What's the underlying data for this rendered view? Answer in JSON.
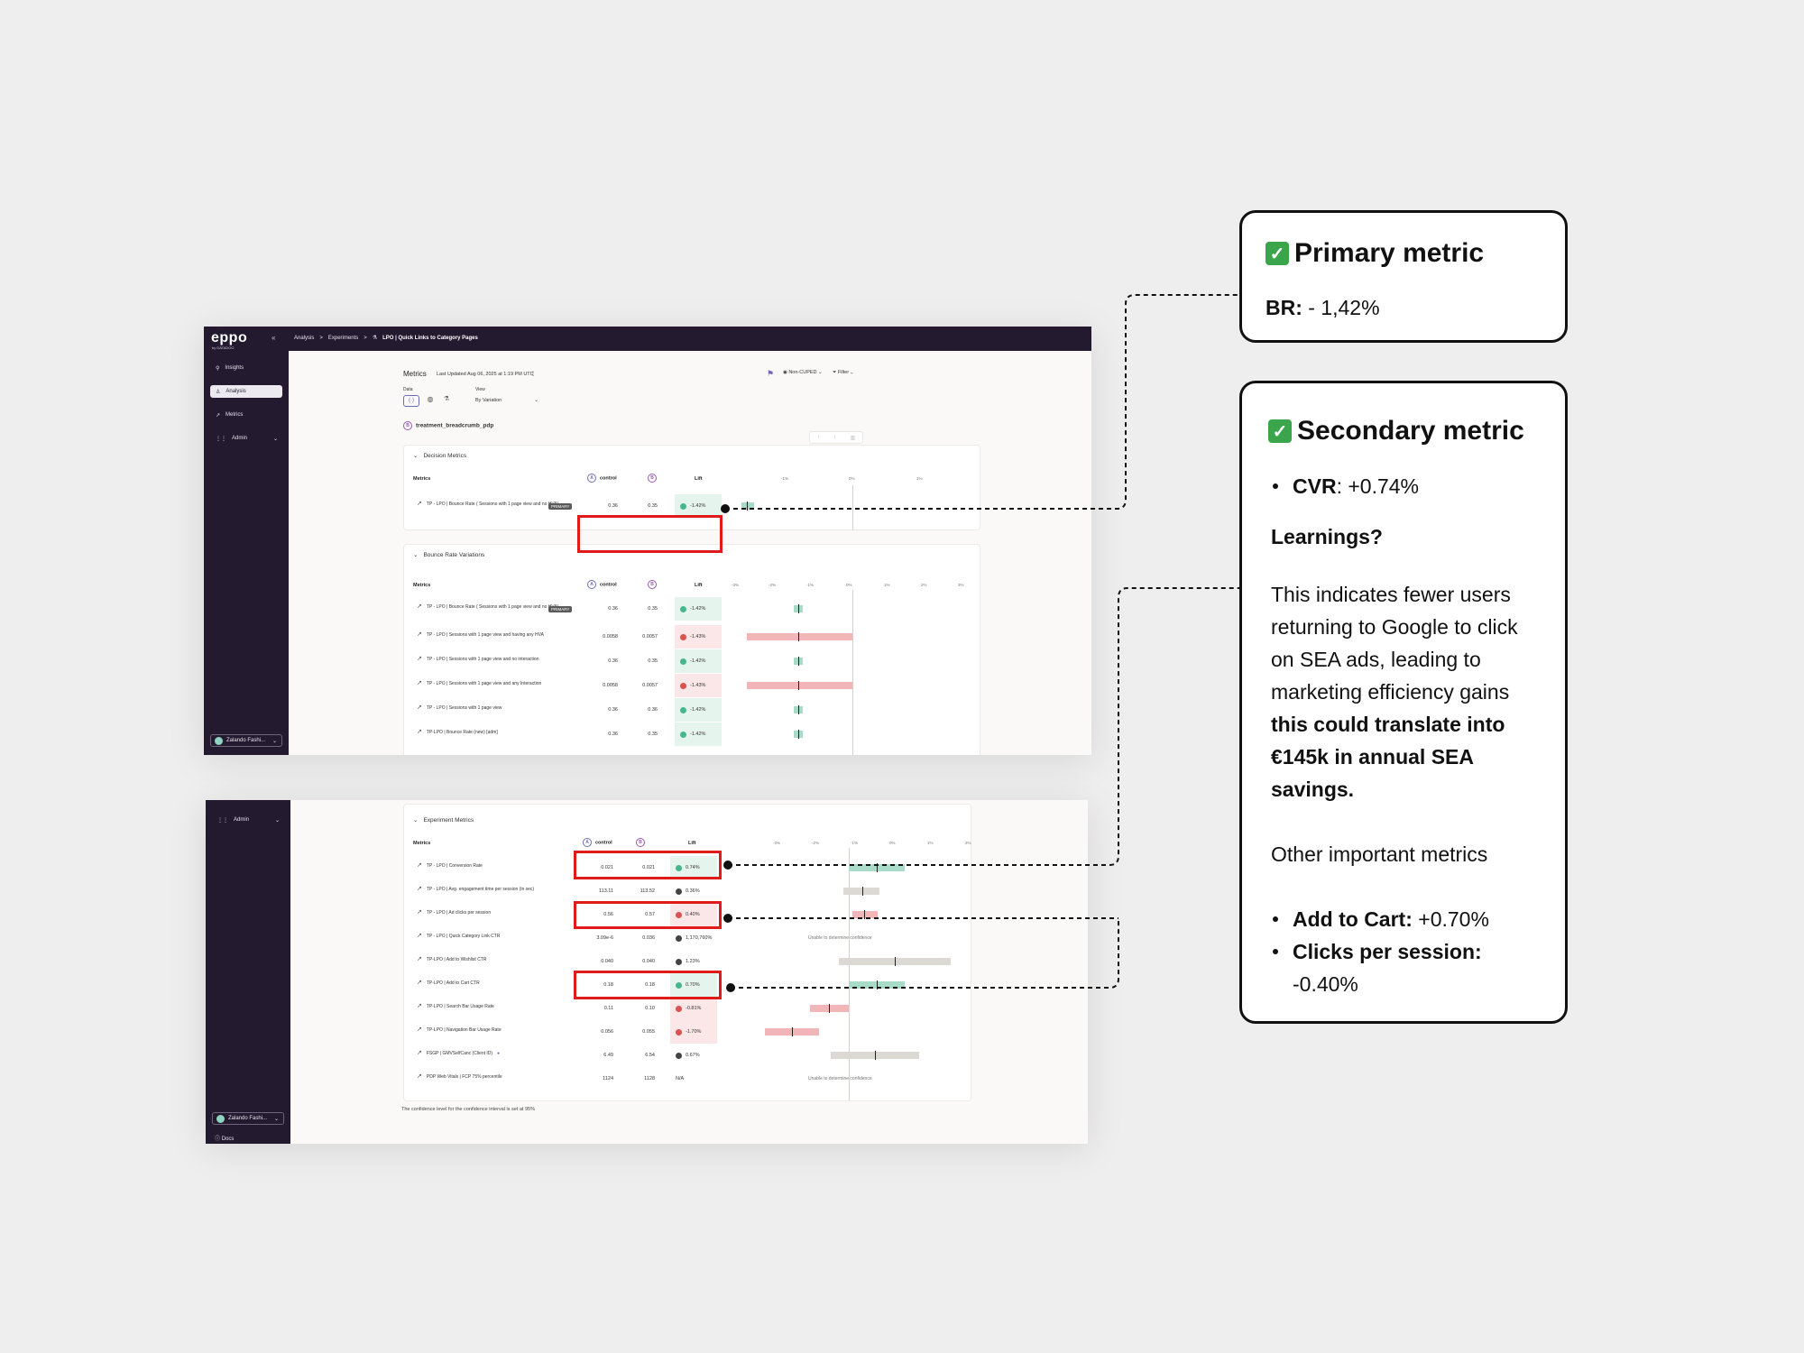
{
  "app": {
    "logo": "eppo",
    "logo_sub": "by DATADOG",
    "collapse_icon": "«",
    "breadcrumbs": [
      "Analysis",
      ">",
      "Experiments",
      ">"
    ],
    "breadcrumb_current": "LPO | Quick Links to Category Pages"
  },
  "sidebar": {
    "items": [
      {
        "icon": "bulb-icon",
        "label": "Insights"
      },
      {
        "icon": "person-icon",
        "label": "Analysis"
      },
      {
        "icon": "metric-icon",
        "label": "Metrics"
      },
      {
        "icon": "sliders-icon",
        "label": "Admin"
      }
    ],
    "org": "Zalando Fashi...",
    "docs": "Docs"
  },
  "metrics_header": {
    "title": "Metrics",
    "last_updated": "Last Updated  Aug 06, 2025 at 1:19 PM UTC",
    "data_label": "Data",
    "view_label": "View",
    "view_value": "By Variation",
    "cuped": "Non-CUPED",
    "filter": "Filter",
    "variant": "treatment_breadcrumb_pdp"
  },
  "columns": {
    "metrics": "Metrics",
    "a": "A",
    "control": "control",
    "b": "B",
    "lift": "Lift"
  },
  "decision": {
    "title": "Decision Metrics",
    "axis": [
      "-1%",
      "0%",
      "1%"
    ],
    "rows": [
      {
        "name": "TP - LPO | Bounce Rate ( Sessions with 1 page view and no HVA)",
        "badge": "PRIMARY",
        "control": "0.36",
        "treatment": "0.35",
        "lift": "-1.42%",
        "dir": "pos"
      }
    ]
  },
  "bounce": {
    "title": "Bounce Rate Variations",
    "axis": [
      "-3%",
      "-2%",
      "-1%",
      "0%",
      "1%",
      "2%",
      "3%"
    ],
    "rows": [
      {
        "name": "TP - LPO | Bounce Rate ( Sessions with 1 page view and no HVA)",
        "badge": "PRIMARY",
        "control": "0.36",
        "treatment": "0.35",
        "lift": "-1.42%",
        "dir": "pos"
      },
      {
        "name": "TP - LPO | Sessions with 1 page view and having any HVA",
        "control": "0.0058",
        "treatment": "0.0057",
        "lift": "-1.43%",
        "dir": "neg"
      },
      {
        "name": "TP - LPO | Sessions with 1 page view and no interaction",
        "control": "0.36",
        "treatment": "0.35",
        "lift": "-1.42%",
        "dir": "pos"
      },
      {
        "name": "TP - LPO | Sessions with 1 page view and any Interaction",
        "control": "0.0058",
        "treatment": "0.0057",
        "lift": "-1.43%",
        "dir": "neg"
      },
      {
        "name": "TP - LPO | Sessions with 1 page view",
        "control": "0.36",
        "treatment": "0.36",
        "lift": "-1.42%",
        "dir": "pos"
      },
      {
        "name": "TP-LPO | Bounce Rate (new) [adm]",
        "control": "0.36",
        "treatment": "0.35",
        "lift": "-1.42%",
        "dir": "pos"
      }
    ]
  },
  "experiment": {
    "title": "Experiment Metrics",
    "axis": [
      "-3%",
      "-2%",
      "-1%",
      "0%",
      "1%",
      "2%"
    ],
    "unable": "Unable to determine confidence",
    "footer": "The confidence level for the confidence interval is set at 95%",
    "rows": [
      {
        "name": "TP - LPO | Conversion Rate",
        "control": "0.021",
        "treatment": "0.021",
        "lift": "0.74%",
        "dir": "pos"
      },
      {
        "name": "TP - LPO | Avg. engagement time per session (in sec)",
        "control": "113.11",
        "treatment": "113.52",
        "lift": "0.36%",
        "dir": "neu"
      },
      {
        "name": "TP - LPO | Ad clicks per session",
        "control": "0.56",
        "treatment": "0.57",
        "lift": "0.40%",
        "dir": "neg"
      },
      {
        "name": "TP - LPO | Quick Category Link CTR",
        "control": "3.09e-6",
        "treatment": "0.036",
        "lift": "1,170,760%",
        "dir": "neu"
      },
      {
        "name": "TP-LPO | Add to Wishlist CTR",
        "control": "0.040",
        "treatment": "0.040",
        "lift": "1.23%",
        "dir": "neu"
      },
      {
        "name": "TP-LPO | Add to Cart CTR",
        "control": "0.18",
        "treatment": "0.18",
        "lift": "0.70%",
        "dir": "pos"
      },
      {
        "name": "TP-LPO | Search Bar Usage Rate",
        "control": "0.11",
        "treatment": "0.10",
        "lift": "-0.81%",
        "dir": "neg"
      },
      {
        "name": "TP-LPO | Navigation Bar Usage Rate",
        "control": "0.056",
        "treatment": "0.055",
        "lift": "-1.70%",
        "dir": "neg"
      },
      {
        "name": "FSGP | GMVSelfCanc (Client ID)",
        "control": "6.49",
        "treatment": "6.54",
        "lift": "0.67%",
        "dir": "neu"
      },
      {
        "name": "PDP Web Vitals | FCP 75% percentile",
        "control": "1124",
        "treatment": "1128",
        "lift": "N/A",
        "dir": "none"
      }
    ]
  },
  "callout_primary": {
    "title": "Primary metric",
    "label": "BR:",
    "value": " - 1,42%"
  },
  "callout_secondary": {
    "title": "Secondary metric",
    "cvr_label": "CVR",
    "cvr_value": ": +0.74%",
    "learnings": "Learnings?",
    "text_plain": "This indicates fewer users returning to Google to click on SEA ads, leading to marketing efficiency gains ",
    "text_bold": "this could translate into €145k in annual SEA savings.",
    "other": "Other important metrics",
    "atc_label": "Add to Cart:",
    "atc_value": " +0.70%",
    "cps_label": "Clicks per session:",
    "cps_value": "-0.40%"
  },
  "colors": {
    "brand_dark": "#241a30",
    "positive": "#47b68c",
    "negative": "#d9534f",
    "highlight": "#e11a1a"
  }
}
